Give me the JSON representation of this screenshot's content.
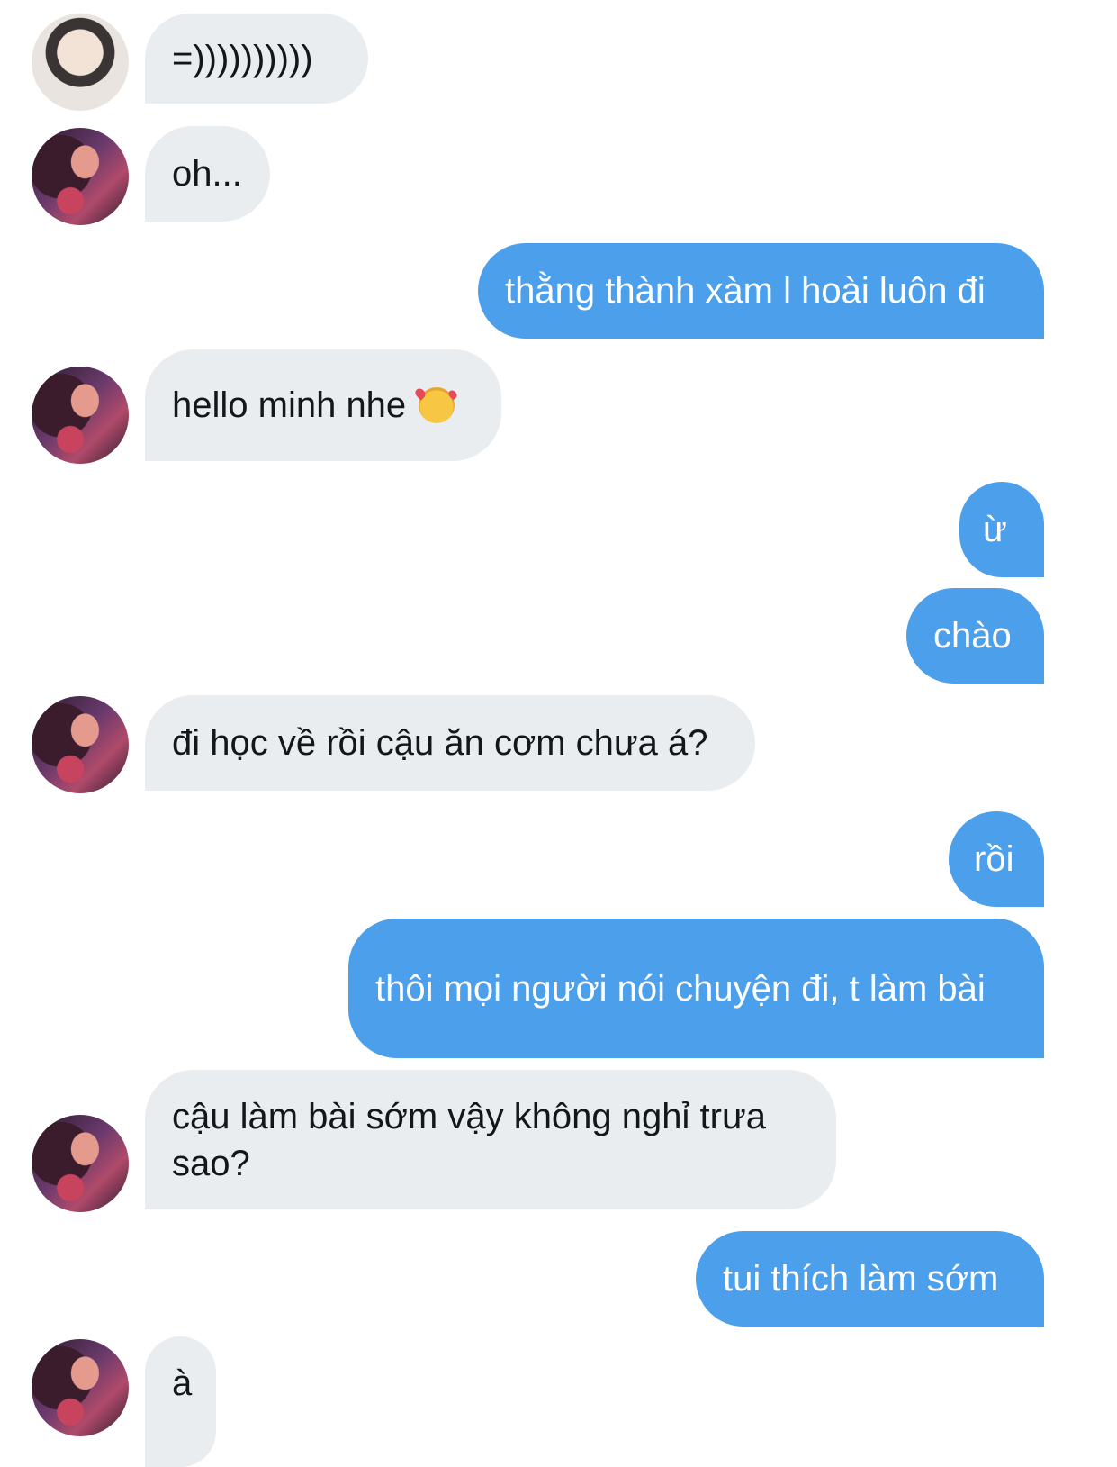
{
  "conversation": {
    "messages": [
      {
        "from": "them",
        "avatar": "avatar-photo-1",
        "text": "=))))))))))"
      },
      {
        "from": "them",
        "avatar": "avatar-photo-2",
        "text": "oh..."
      },
      {
        "from": "me",
        "text": "thằng thành xàm l hoài luôn đi"
      },
      {
        "from": "them",
        "avatar": "avatar-photo-2",
        "text": "hello minh nhe",
        "emoji": "smiling-face-with-hearts-icon"
      },
      {
        "from": "me",
        "text": "ừ"
      },
      {
        "from": "me",
        "text": "chào"
      },
      {
        "from": "them",
        "avatar": "avatar-photo-2",
        "text": "đi học về rồi cậu ăn cơm chưa á?"
      },
      {
        "from": "me",
        "text": "rồi"
      },
      {
        "from": "me",
        "text": "thôi mọi người nói chuyện đi, t làm bài"
      },
      {
        "from": "them",
        "avatar": "avatar-photo-2",
        "text": "cậu làm bài sớm vậy không nghỉ trưa sao?"
      },
      {
        "from": "me",
        "text": "tui thích làm sớm"
      },
      {
        "from": "them",
        "avatar": "avatar-photo-2",
        "text": "à"
      }
    ]
  },
  "colors": {
    "incoming_bubble": "#e9edf0",
    "outgoing_bubble": "#4c9fea",
    "incoming_text": "#14171a",
    "outgoing_text": "#ffffff"
  }
}
